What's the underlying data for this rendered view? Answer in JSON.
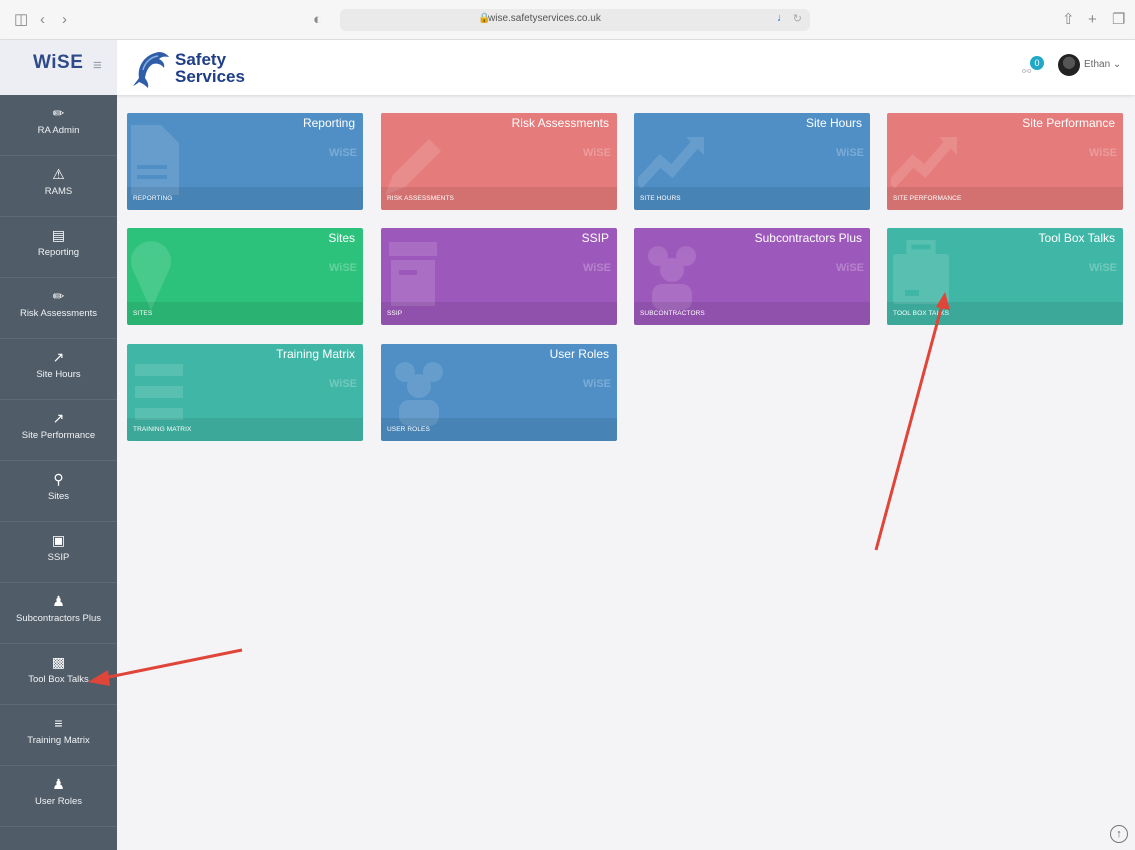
{
  "browser": {
    "url": "wise.safetyservices.co.uk",
    "icons": [
      "sidebar-toggle-icon",
      "back-icon",
      "forward-icon",
      "shield-icon",
      "share-icon",
      "new-tab-icon",
      "tabs-icon"
    ]
  },
  "header": {
    "app_logo": "WiSE",
    "company_line1": "Safety",
    "company_line2": "Services",
    "notification_count": "0",
    "user_name": "Ethan ⌄"
  },
  "sidebar": {
    "items": [
      {
        "label": "RA Admin",
        "icon": "pencil-icon"
      },
      {
        "label": "RAMS",
        "icon": "warning-icon"
      },
      {
        "label": "Reporting",
        "icon": "document-icon"
      },
      {
        "label": "Risk Assessments",
        "icon": "pencil-icon"
      },
      {
        "label": "Site Hours",
        "icon": "chart-line-icon"
      },
      {
        "label": "Site Performance",
        "icon": "chart-line-icon"
      },
      {
        "label": "Sites",
        "icon": "map-pin-icon"
      },
      {
        "label": "SSIP",
        "icon": "archive-icon"
      },
      {
        "label": "Subcontractors Plus",
        "icon": "users-icon"
      },
      {
        "label": "Tool Box Talks",
        "icon": "briefcase-icon"
      },
      {
        "label": "Training Matrix",
        "icon": "list-icon"
      },
      {
        "label": "User Roles",
        "icon": "users-icon"
      }
    ]
  },
  "tiles": [
    {
      "title": "Reporting",
      "footer": "REPORTING",
      "color": "#4f8fc6",
      "icon": "document-icon"
    },
    {
      "title": "Risk Assessments",
      "footer": "RISK ASSESSMENTS",
      "color": "#e57b7b",
      "icon": "pencil-icon"
    },
    {
      "title": "Site Hours",
      "footer": "SITE HOURS",
      "color": "#4f8fc6",
      "icon": "chart-line-icon"
    },
    {
      "title": "Site Performance",
      "footer": "SITE PERFORMANCE",
      "color": "#e57b7b",
      "icon": "chart-line-icon"
    },
    {
      "title": "Sites",
      "footer": "SITES",
      "color": "#2dc27c",
      "icon": "map-pin-icon"
    },
    {
      "title": "SSIP",
      "footer": "SSIP",
      "color": "#9d58bb",
      "icon": "archive-icon"
    },
    {
      "title": "Subcontractors Plus",
      "footer": "SUBCONTRACTORS",
      "color": "#9d58bb",
      "icon": "users-icon"
    },
    {
      "title": "Tool Box Talks",
      "footer": "TOOL BOX TALKS",
      "color": "#40b7a6",
      "icon": "briefcase-icon"
    },
    {
      "title": "Training Matrix",
      "footer": "TRAINING MATRIX",
      "color": "#40b7a6",
      "icon": "list-icon"
    },
    {
      "title": "User Roles",
      "footer": "USER ROLES",
      "color": "#4f8fc6",
      "icon": "users-icon"
    }
  ],
  "tile_watermark": "WiSE",
  "annotation_color": "#e0453a"
}
